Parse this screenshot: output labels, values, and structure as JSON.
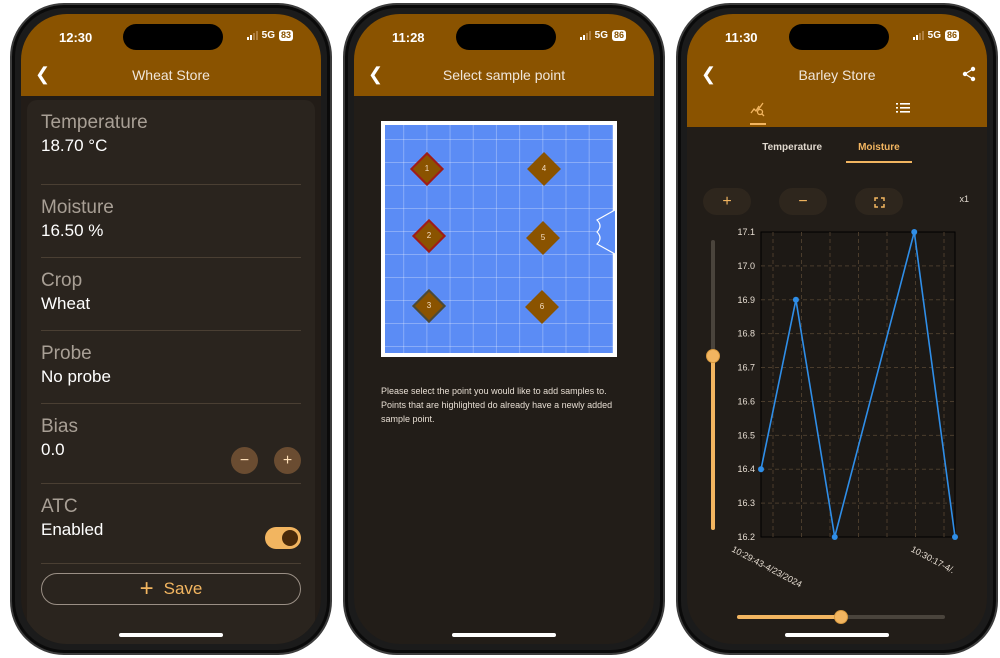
{
  "phones": [
    {
      "status": {
        "time": "12:30",
        "network": "5G",
        "battery": "83"
      },
      "header": {
        "title": "Wheat Store"
      },
      "fields": [
        {
          "label": "Temperature",
          "value": "18.70 °C"
        },
        {
          "label": "Moisture",
          "value": "16.50 %"
        },
        {
          "label": "Crop",
          "value": "Wheat"
        },
        {
          "label": "Probe",
          "value": "No probe"
        },
        {
          "label": "Bias",
          "value": "0.0"
        },
        {
          "label": "ATC",
          "value": "Enabled"
        }
      ],
      "bias_controls": {
        "decrement": "−",
        "increment": "+"
      },
      "atc_toggle_on": true,
      "save_button": {
        "icon": "+",
        "label": "Save"
      }
    },
    {
      "status": {
        "time": "11:28",
        "network": "5G",
        "battery": "86"
      },
      "header": {
        "title": "Select sample point"
      },
      "points": [
        {
          "label": "1",
          "highlight": "red"
        },
        {
          "label": "2",
          "highlight": "red"
        },
        {
          "label": "3",
          "highlight": "gray"
        },
        {
          "label": "4",
          "highlight": "none"
        },
        {
          "label": "5",
          "highlight": "none"
        },
        {
          "label": "6",
          "highlight": "none"
        }
      ],
      "instructions": "Please select the point you would like to add samples to. Points that are highlighted do already have a newly added sample point."
    },
    {
      "status": {
        "time": "11:30",
        "network": "5G",
        "battery": "86"
      },
      "header": {
        "title": "Barley Store"
      },
      "tabs": [
        {
          "icon": "chart-search-icon",
          "active": true
        },
        {
          "icon": "list-icon",
          "active": false
        }
      ],
      "subtabs": [
        {
          "label": "Temperature",
          "active": false
        },
        {
          "label": "Moisture",
          "active": true
        }
      ],
      "zoom_controls": {
        "zoom_in": "+",
        "zoom_out": "−",
        "fit": "⛶",
        "level": "x1"
      },
      "vertical_slider_value": 0.6,
      "horizontal_slider_value": 0.5
    }
  ],
  "colors": {
    "brand": "#8a5300",
    "accent": "#f2b560",
    "line": "#2f8ee8",
    "map": "#5b8cf5"
  },
  "chart_data": {
    "type": "line",
    "title": "",
    "xlabel": "",
    "ylabel": "",
    "series": [
      {
        "name": "Moisture",
        "values": [
          16.4,
          16.9,
          16.2,
          17.1,
          16.2
        ]
      }
    ],
    "x_positions": [
      0.0,
      0.18,
      0.38,
      0.79,
      1.0
    ],
    "x_tick_labels": [
      "10:29:43-4/23/2024",
      "10:30:17-4/."
    ],
    "y_ticks": [
      16.2,
      16.3,
      16.4,
      16.5,
      16.6,
      16.7,
      16.8,
      16.9,
      17.0,
      17.1
    ],
    "y_tick_labels": [
      "16.2",
      "16.3",
      "16.4",
      "16.5",
      "16.6",
      "16.7",
      "16.8",
      "16.9",
      "17.0",
      "17.1"
    ],
    "ylim": [
      16.2,
      17.1
    ],
    "grid": true,
    "legend": "none"
  }
}
